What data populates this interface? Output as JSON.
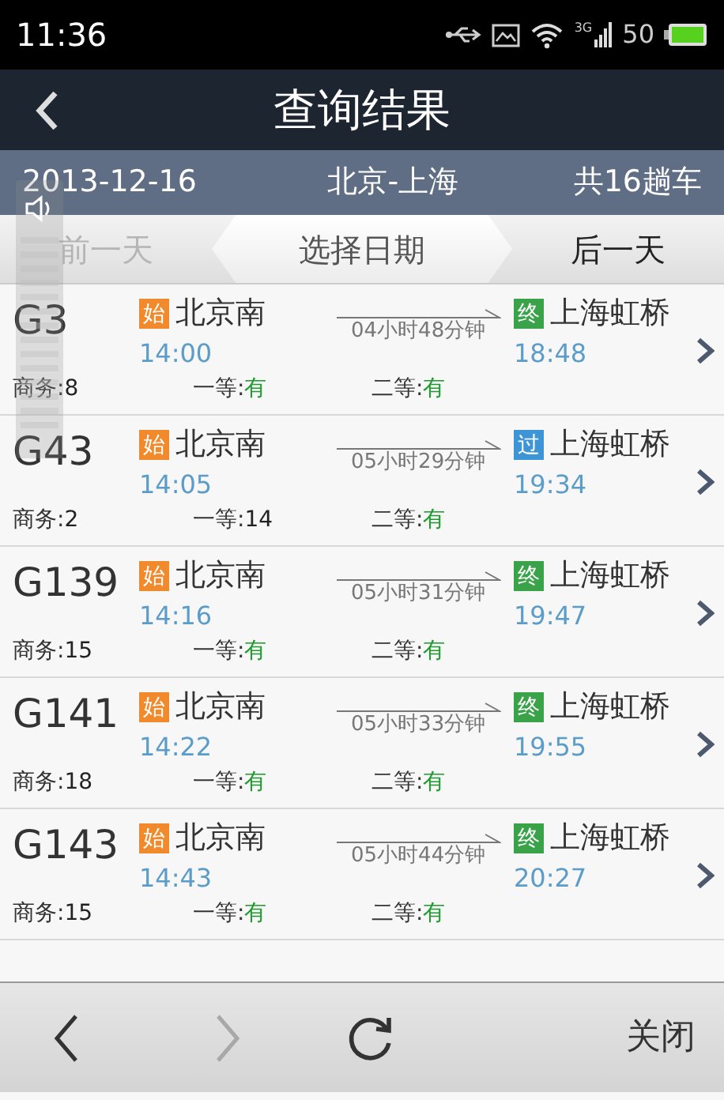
{
  "status_bar": {
    "time": "11:36",
    "network": "3G",
    "battery_text": "50"
  },
  "header": {
    "title": "查询结果"
  },
  "summary": {
    "date": "2013-12-16",
    "route": "北京-上海",
    "count": "共16趟车"
  },
  "day_nav": [
    {
      "label": "前一天",
      "kind": "prev",
      "disabled": true
    },
    {
      "label": "选择日期",
      "kind": "pick",
      "disabled": false
    },
    {
      "label": "后一天",
      "kind": "next",
      "disabled": false
    }
  ],
  "trains": [
    {
      "number": "G3",
      "from_badge": {
        "text": "始",
        "kind": "start"
      },
      "from": "北京南",
      "depart": "14:00",
      "duration": "04小时48分钟",
      "to_badge": {
        "text": "终",
        "kind": "end"
      },
      "to": "上海虹桥",
      "arrive": "18:48",
      "seats": [
        {
          "label": "商务:",
          "value": "8",
          "available": false
        },
        {
          "label": "一等:",
          "value": "有",
          "available": true
        },
        {
          "label": "二等:",
          "value": "有",
          "available": true
        }
      ]
    },
    {
      "number": "G43",
      "from_badge": {
        "text": "始",
        "kind": "start"
      },
      "from": "北京南",
      "depart": "14:05",
      "duration": "05小时29分钟",
      "to_badge": {
        "text": "过",
        "kind": "pass"
      },
      "to": "上海虹桥",
      "arrive": "19:34",
      "seats": [
        {
          "label": "商务:",
          "value": "2",
          "available": false
        },
        {
          "label": "一等:",
          "value": "14",
          "available": false
        },
        {
          "label": "二等:",
          "value": "有",
          "available": true
        }
      ]
    },
    {
      "number": "G139",
      "from_badge": {
        "text": "始",
        "kind": "start"
      },
      "from": "北京南",
      "depart": "14:16",
      "duration": "05小时31分钟",
      "to_badge": {
        "text": "终",
        "kind": "end"
      },
      "to": "上海虹桥",
      "arrive": "19:47",
      "seats": [
        {
          "label": "商务:",
          "value": "15",
          "available": false
        },
        {
          "label": "一等:",
          "value": "有",
          "available": true
        },
        {
          "label": "二等:",
          "value": "有",
          "available": true
        }
      ]
    },
    {
      "number": "G141",
      "from_badge": {
        "text": "始",
        "kind": "start"
      },
      "from": "北京南",
      "depart": "14:22",
      "duration": "05小时33分钟",
      "to_badge": {
        "text": "终",
        "kind": "end"
      },
      "to": "上海虹桥",
      "arrive": "19:55",
      "seats": [
        {
          "label": "商务:",
          "value": "18",
          "available": false
        },
        {
          "label": "一等:",
          "value": "有",
          "available": true
        },
        {
          "label": "二等:",
          "value": "有",
          "available": true
        }
      ]
    },
    {
      "number": "G143",
      "from_badge": {
        "text": "始",
        "kind": "start"
      },
      "from": "北京南",
      "depart": "14:43",
      "duration": "05小时44分钟",
      "to_badge": {
        "text": "终",
        "kind": "end"
      },
      "to": "上海虹桥",
      "arrive": "20:27",
      "seats": [
        {
          "label": "商务:",
          "value": "15",
          "available": false
        },
        {
          "label": "一等:",
          "value": "有",
          "available": true
        },
        {
          "label": "二等:",
          "value": "有",
          "available": true
        }
      ]
    }
  ],
  "toolbar": {
    "forward_disabled": true,
    "close": "关闭"
  }
}
